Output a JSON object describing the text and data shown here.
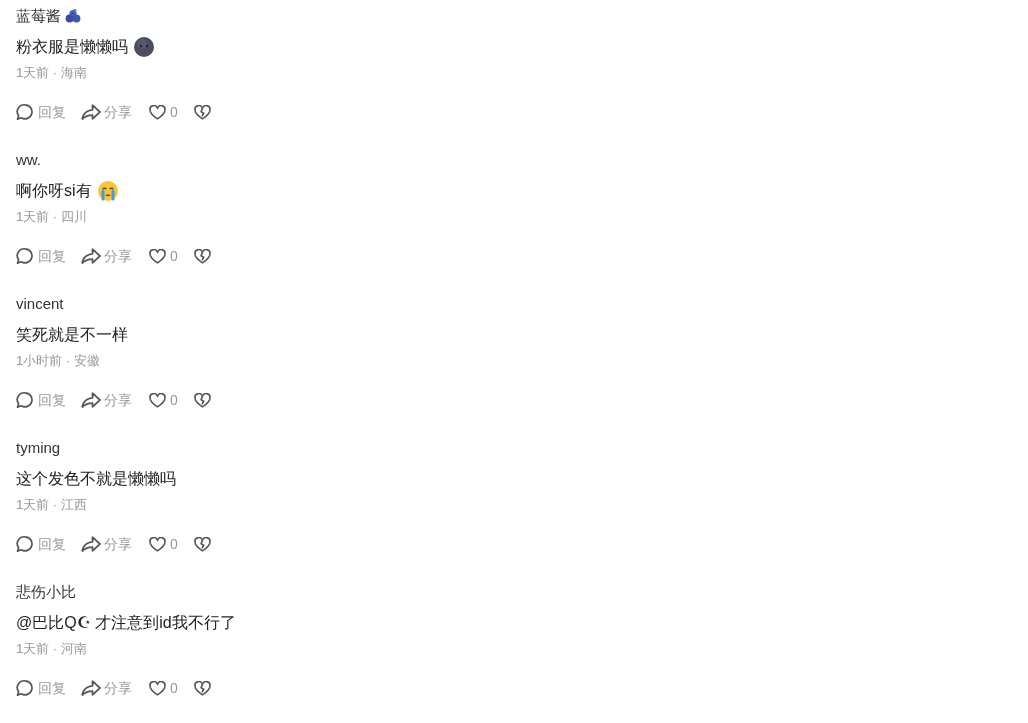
{
  "comments": [
    {
      "user": "蓝莓酱",
      "user_emoji": {
        "kind": "blueberry"
      },
      "text": "粉衣服是懒懒吗",
      "text_emoji": {
        "kind": "new-moon-face"
      },
      "meta": "1天前 · 海南",
      "actions": {
        "reply": "回复",
        "share": "分享",
        "likes": "0"
      }
    },
    {
      "user": "ww.",
      "text": "啊你呀si有",
      "text_emoji": {
        "kind": "crying-face"
      },
      "meta": "1天前 · 四川",
      "actions": {
        "reply": "回复",
        "share": "分享",
        "likes": "0"
      }
    },
    {
      "user": "vincent",
      "text": "笑死就是不一样",
      "meta": "1小时前 · 安徽",
      "actions": {
        "reply": "回复",
        "share": "分享",
        "likes": "0"
      }
    },
    {
      "user": "tyming",
      "text": "这个发色不就是懒懒吗",
      "meta": "1天前 · 江西",
      "actions": {
        "reply": "回复",
        "share": "分享",
        "likes": "0"
      }
    },
    {
      "user": "悲伤小比",
      "text": "@巴比Q☪ 才注意到id我不行了",
      "meta": "1天前 · 河南",
      "actions": {
        "reply": "回复",
        "share": "分享",
        "likes": "0"
      }
    }
  ]
}
